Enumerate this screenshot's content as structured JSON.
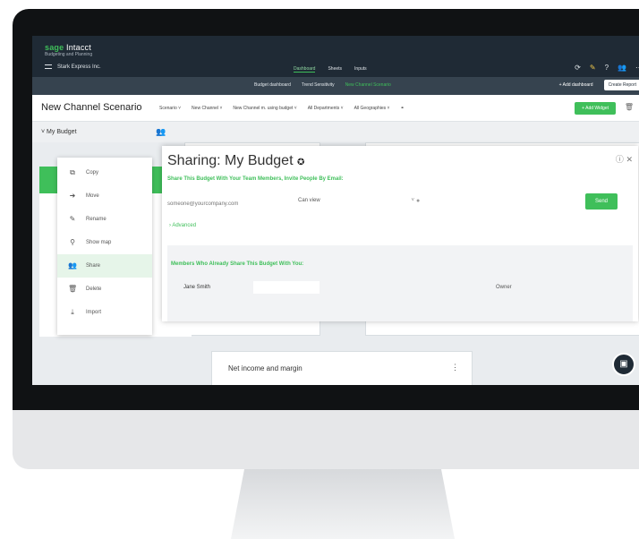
{
  "app": {
    "brand_prefix": "sage",
    "brand_suffix": " Intacct",
    "brand_sub": "Budgeting and Planning",
    "company": "Stark Express Inc."
  },
  "topnav": {
    "items": [
      "Dashboard",
      "Sheets",
      "Inputs"
    ],
    "active": "Dashboard"
  },
  "subnav": {
    "items": [
      "Budget dashboard",
      "Trend Sensitivity",
      "New Channel Scenario"
    ],
    "active": "New Channel Scenario",
    "add_dashboard": "+ Add dashboard",
    "create_report": "Create Report"
  },
  "scenario": {
    "title": "New Channel Scenario",
    "filters": [
      "Scenario",
      "New Channel",
      "New Channel m. using budget",
      "All Departments",
      "All Geographies"
    ],
    "add_widget": "+ Add Widget"
  },
  "sidebar": {
    "budget_label": "My Budget"
  },
  "context_menu": {
    "items": [
      {
        "label": "Copy",
        "icon": "copy-icon",
        "glyph": "⧉"
      },
      {
        "label": "Move",
        "icon": "arrow-right-icon",
        "glyph": "➜"
      },
      {
        "label": "Rename",
        "icon": "pencil-icon",
        "glyph": "✎"
      },
      {
        "label": "Show map",
        "icon": "map-pin-icon",
        "glyph": "⚲"
      },
      {
        "label": "Share",
        "icon": "people-icon",
        "glyph": "👥"
      },
      {
        "label": "Delete",
        "icon": "trash-icon",
        "glyph": "🗑"
      },
      {
        "label": "Import",
        "icon": "import-icon",
        "glyph": "⤓"
      }
    ],
    "active": "Share"
  },
  "dialog": {
    "title": "Sharing: My Budget",
    "subtitle": "Share This Budget With Your Team Members, Invite People By Email:",
    "email_placeholder": "someone@yourcompany.com",
    "permission": "Can view",
    "send_label": "Send",
    "advanced_label": "Advanced",
    "members_title": "Members Who Already Share This Budget With You:",
    "members": [
      {
        "name": "Jane Smith",
        "role": "Owner"
      }
    ]
  },
  "bottom_card": {
    "title": "Net income and margin"
  },
  "colors": {
    "accent": "#3fbf5a",
    "topbar": "#1f2a35",
    "subbar": "#36434f"
  }
}
